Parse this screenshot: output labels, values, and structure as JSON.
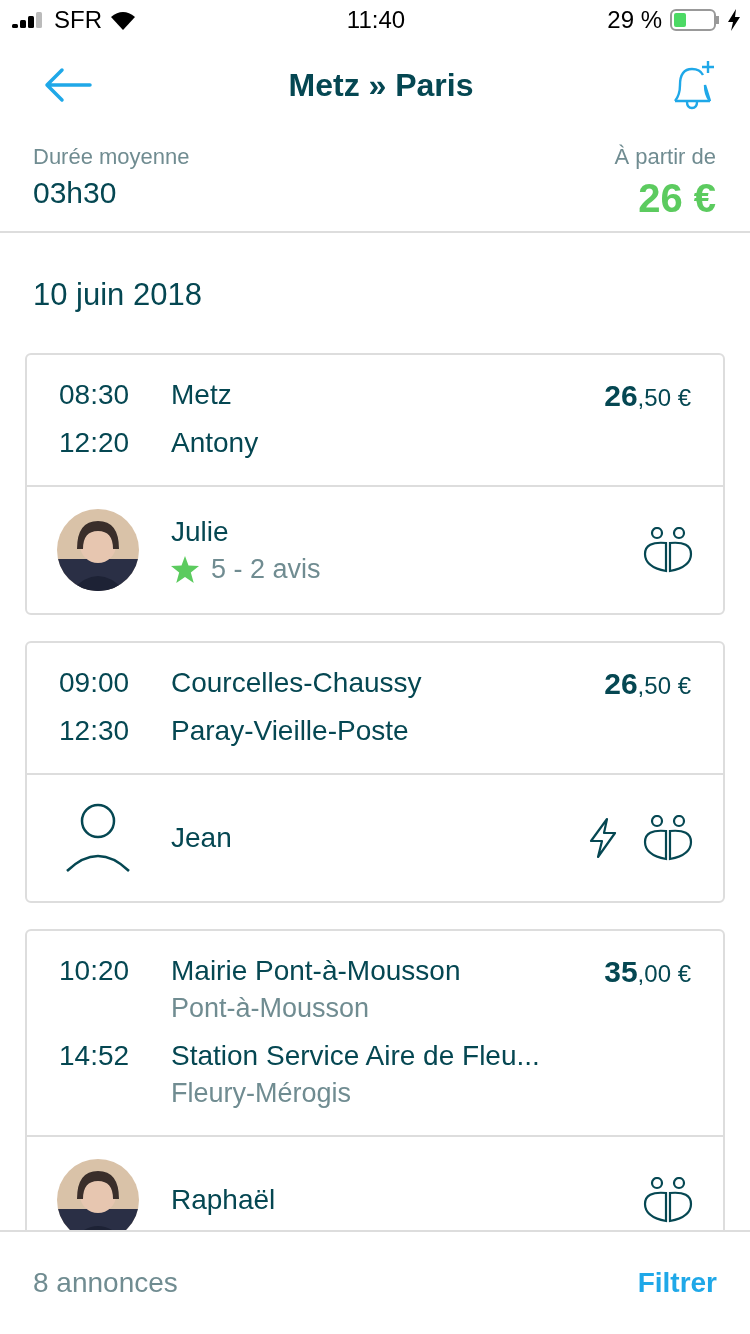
{
  "status_bar": {
    "carrier": "SFR",
    "time": "11:40",
    "battery": "29 %"
  },
  "header": {
    "title": "Metz » Paris"
  },
  "summary": {
    "duration_label": "Durée moyenne",
    "duration": "03h30",
    "price_label": "À partir de",
    "price": "26 €"
  },
  "date": "10 juin 2018",
  "rides": [
    {
      "stops": [
        {
          "time": "08:30",
          "place": "Metz"
        },
        {
          "time": "12:20",
          "place": "Antony"
        }
      ],
      "price": "**26**,50 €",
      "driver": {
        "name": "Julie",
        "rating": "5 - 2 avis"
      },
      "instant": false,
      "two_back": true
    },
    {
      "stops": [
        {
          "time": "09:00",
          "place": "Courcelles-Chaussy"
        },
        {
          "time": "12:30",
          "place": "Paray-Vieille-Poste"
        }
      ],
      "price": "**26**,50 €",
      "driver": {
        "name": "Jean",
        "kind": "placeholder"
      },
      "instant": true,
      "two_back": true
    },
    {
      "stops": [
        {
          "time": "10:20",
          "place": "Mairie Pont-à-Mousson",
          "city": "Pont-à-Mousson"
        },
        {
          "time": "14:52",
          "place": "Station Service Aire de Fleu...",
          "city": "Fleury-Mérogis"
        }
      ],
      "price": "**35**,00 €",
      "driver": {
        "name": "Raphaël"
      },
      "instant": false,
      "two_back": true
    }
  ],
  "footer": {
    "count": "8 annonces",
    "filter": "Filtrer"
  }
}
